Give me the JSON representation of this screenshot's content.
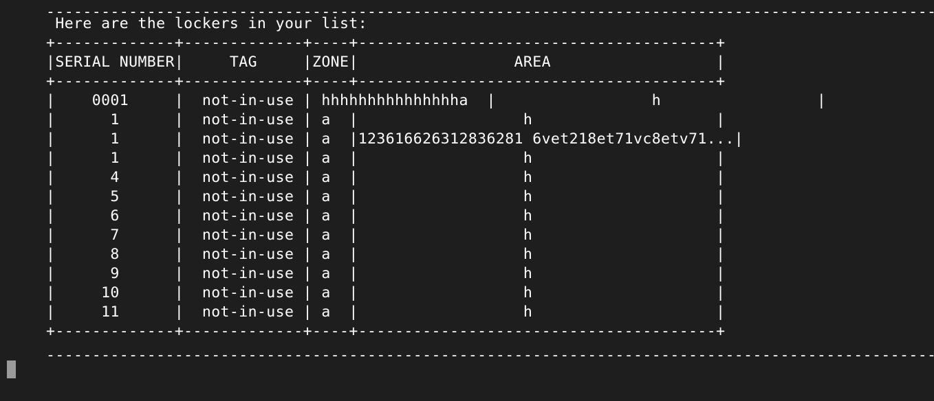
{
  "terminal": {
    "rule_top": "--------------------------------------------------------------------------------------------------------------------------------",
    "heading": " Here are the lockers in your list:",
    "table": {
      "border": "+-------------+-------------+----+---------------------------------------+",
      "header": "|SERIAL NUMBER|     TAG     |ZONE|                 AREA                  |",
      "rows": [
        "|    0001     |  not-in-use | hhhhhhhhhhhhhhha  |                 h                 |",
        "|      1      |  not-in-use | a  |                  h                    |",
        "|      1      |  not-in-use | a  |123616626312836281 6vet218et71vc8etv71...|",
        "|      1      |  not-in-use | a  |                  h                    |",
        "|      4      |  not-in-use | a  |                  h                    |",
        "|      5      |  not-in-use | a  |                  h                    |",
        "|      6      |  not-in-use | a  |                  h                    |",
        "|      7      |  not-in-use | a  |                  h                    |",
        "|      8      |  not-in-use | a  |                  h                    |",
        "|      9      |  not-in-use | a  |                  h                    |",
        "|     10      |  not-in-use | a  |                  h                    |",
        "|     11      |  not-in-use | a  |                  h                    |"
      ]
    },
    "rule_bottom": "--------------------------------------------------------------------------------------------------------------------------------"
  }
}
